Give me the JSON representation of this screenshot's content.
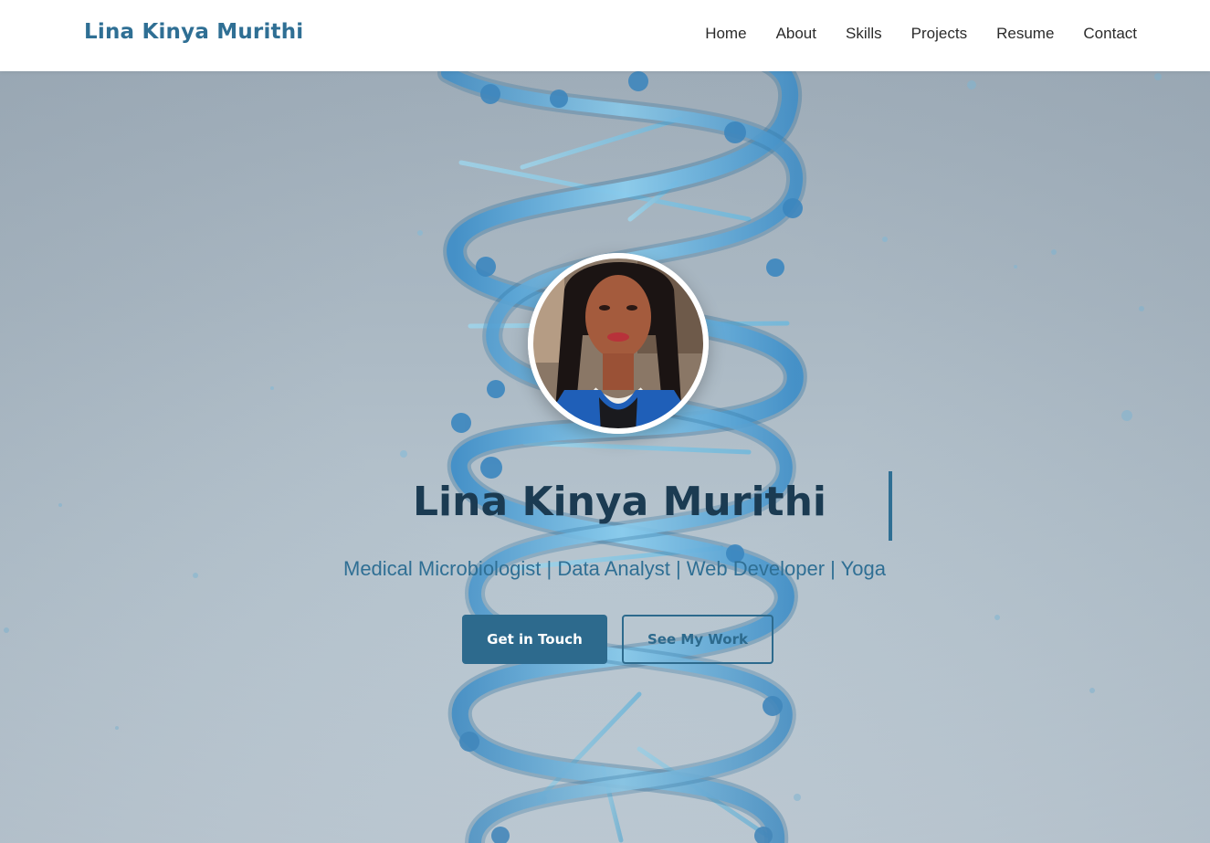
{
  "header": {
    "brand": "Lina Kinya Murithi",
    "nav": [
      {
        "label": "Home"
      },
      {
        "label": "About"
      },
      {
        "label": "Skills"
      },
      {
        "label": "Projects"
      },
      {
        "label": "Resume"
      },
      {
        "label": "Contact"
      }
    ]
  },
  "hero": {
    "title": "Lina Kinya Murithi",
    "subtitle": "Medical Microbiologist | Data Analyst | Web Developer | Yoga",
    "buttons": {
      "primary": "Get in Touch",
      "secondary": "See My Work"
    },
    "background_motif": "dna-helix",
    "avatar_icon": "profile-photo"
  },
  "colors": {
    "brand": "#2f6f94",
    "title": "#1b3b52",
    "primary_button": "#2d6a8d",
    "navbar_bg": "#ffffff",
    "page_bg": "#a9b7c2"
  }
}
